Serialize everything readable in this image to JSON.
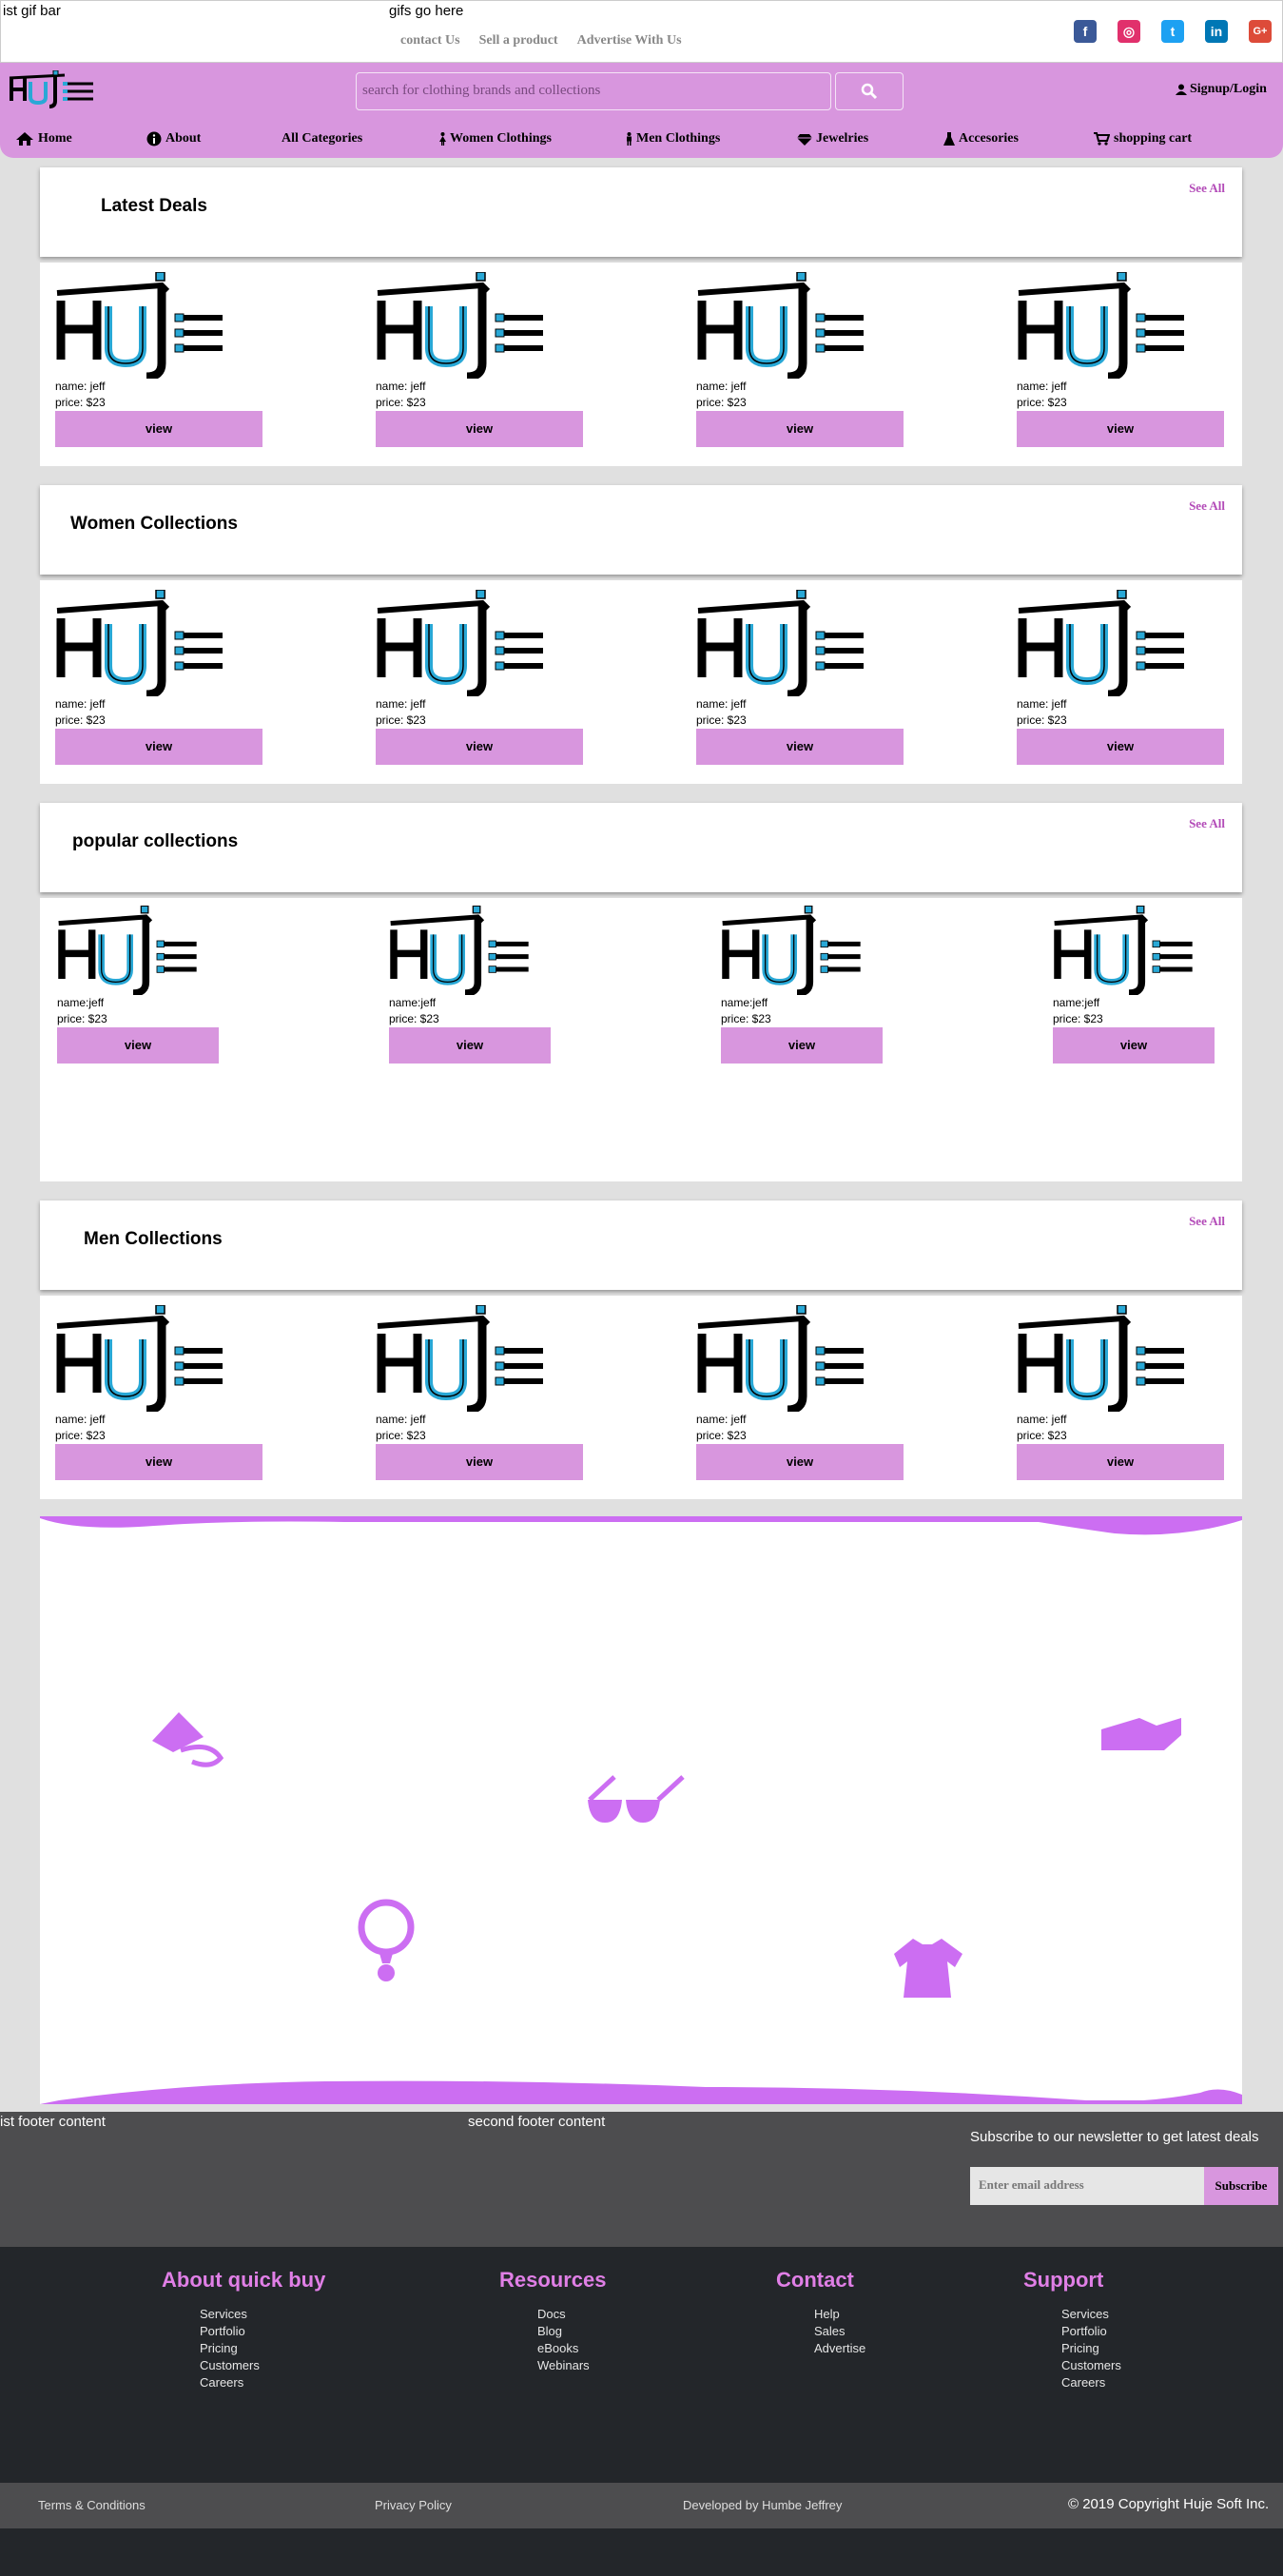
{
  "topbar": {
    "gif_bar_1": "ist gif bar",
    "gif_bar_2": "gifs go here",
    "links": [
      "contact Us",
      "Sell a product",
      "Advertise With Us"
    ],
    "social": [
      {
        "icon": "facebook-icon",
        "glyph": "f",
        "color": "#3b5998"
      },
      {
        "icon": "instagram-icon",
        "glyph": "◎",
        "color": "#e1306c"
      },
      {
        "icon": "twitter-icon",
        "glyph": "t",
        "color": "#1da1f2"
      },
      {
        "icon": "linkedin-icon",
        "glyph": "in",
        "color": "#0077b5"
      },
      {
        "icon": "google-plus-icon",
        "glyph": "G+",
        "color": "#dd4b39"
      }
    ]
  },
  "header": {
    "search_placeholder": "search for clothing brands and collections",
    "signup": "Signup/Login",
    "accent": "#d896de"
  },
  "nav": [
    {
      "label": "Home",
      "icon": "home-icon"
    },
    {
      "label": "About",
      "icon": "info-icon"
    },
    {
      "label": "All Categories",
      "icon": ""
    },
    {
      "label": "Women Clothings",
      "icon": "female-icon"
    },
    {
      "label": "Men Clothings",
      "icon": "male-icon"
    },
    {
      "label": "Jewelries",
      "icon": "diamond-icon"
    },
    {
      "label": "Accesories",
      "icon": "flask-icon"
    },
    {
      "label": "shopping cart",
      "icon": "cart-icon"
    }
  ],
  "sections": [
    {
      "title": "Latest Deals",
      "see_all": "See All",
      "products": [
        {
          "name": "name: jeff",
          "price": "price: $23",
          "button": "view"
        },
        {
          "name": "name: jeff",
          "price": "price: $23",
          "button": "view"
        },
        {
          "name": "name: jeff",
          "price": "price: $23",
          "button": "view"
        },
        {
          "name": "name: jeff",
          "price": "price: $23",
          "button": "view"
        }
      ]
    },
    {
      "title": "Women Collections",
      "see_all": "See All",
      "products": [
        {
          "name": "name: jeff",
          "price": "price: $23",
          "button": "view"
        },
        {
          "name": "name: jeff",
          "price": "price: $23",
          "button": "view"
        },
        {
          "name": "name: jeff",
          "price": "price: $23",
          "button": "view"
        },
        {
          "name": "name: jeff",
          "price": "price: $23",
          "button": "view"
        }
      ]
    },
    {
      "title": "popular collections",
      "see_all": "See All",
      "products": [
        {
          "name": "name:jeff",
          "price": "price: $23",
          "button": "view"
        },
        {
          "name": "name:jeff",
          "price": "price: $23",
          "button": "view"
        },
        {
          "name": "name:jeff",
          "price": "price: $23",
          "button": "view"
        },
        {
          "name": "name:jeff",
          "price": "price: $23",
          "button": "view"
        }
      ]
    },
    {
      "title": "Men Collections",
      "see_all": "See All",
      "products": [
        {
          "name": "name: jeff",
          "price": "price: $23",
          "button": "view"
        },
        {
          "name": "name: jeff",
          "price": "price: $23",
          "button": "view"
        },
        {
          "name": "name: jeff",
          "price": "price: $23",
          "button": "view"
        },
        {
          "name": "name: jeff",
          "price": "price: $23",
          "button": "view"
        }
      ]
    }
  ],
  "footer": {
    "first": "ist footer content",
    "second": "second footer content",
    "newsletter": "Subscribe to our newsletter to get latest deals",
    "email_placeholder": "Enter email address",
    "subscribe": "Subscribe",
    "columns": [
      {
        "title": "About quick buy",
        "items": [
          "Services",
          "Portfolio",
          "Pricing",
          "Customers",
          "Careers"
        ]
      },
      {
        "title": "Resources",
        "items": [
          "Docs",
          "Blog",
          "eBooks",
          "Webinars"
        ]
      },
      {
        "title": "Contact",
        "items": [
          "Help",
          "Sales",
          "Advertise"
        ]
      },
      {
        "title": "Support",
        "items": [
          "Services",
          "Portfolio",
          "Pricing",
          "Customers",
          "Careers"
        ]
      }
    ],
    "bottom": {
      "terms": "Terms & Conditions",
      "privacy": "Privacy Policy",
      "developer": "Developed by Humbe Jeffrey",
      "copyright": "© 2019 Copyright Huje Soft Inc."
    }
  }
}
